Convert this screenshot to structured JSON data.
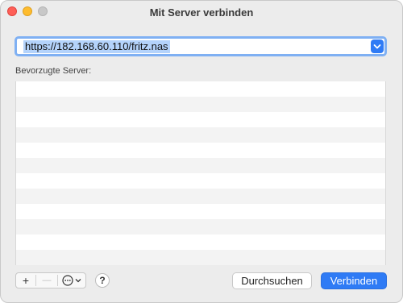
{
  "window": {
    "title": "Mit Server verbinden"
  },
  "address": {
    "value": "https://182.168.60.110/fritz.nas"
  },
  "favorites": {
    "label": "Bevorzugte Server:",
    "rows": 12
  },
  "toolbar": {
    "add": "+",
    "remove": "—",
    "more": "⋯"
  },
  "help": {
    "label": "?"
  },
  "buttons": {
    "browse": "Durchsuchen",
    "connect": "Verbinden"
  },
  "colors": {
    "accent": "#2f7bf5",
    "selection": "#b4d3fb",
    "focus_ring": "#7fb0f3"
  }
}
